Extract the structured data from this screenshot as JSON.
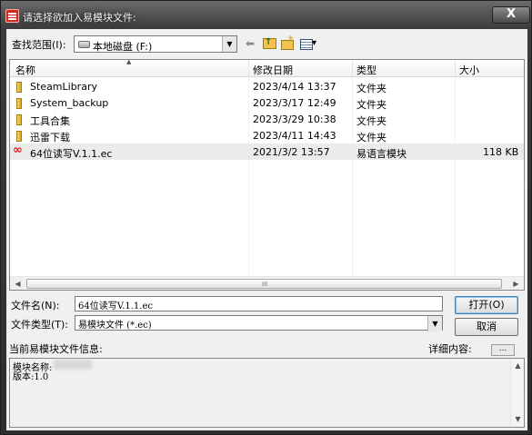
{
  "window": {
    "title": "请选择欲加入易模块文件:",
    "close_label": "X"
  },
  "lookin": {
    "label": "查找范围(I):",
    "value": "本地磁盘 (F:)"
  },
  "columns": {
    "name": "名称",
    "modified": "修改日期",
    "type": "类型",
    "size": "大小"
  },
  "files": [
    {
      "name": "SteamLibrary",
      "modified": "2023/4/14 13:37",
      "type": "文件夹",
      "size": "",
      "icon": "folder-icon"
    },
    {
      "name": "System_backup",
      "modified": "2023/3/17 12:49",
      "type": "文件夹",
      "size": "",
      "icon": "folder-icon"
    },
    {
      "name": "工具合集",
      "modified": "2023/3/29 10:38",
      "type": "文件夹",
      "size": "",
      "icon": "folder-icon"
    },
    {
      "name": "迅雷下载",
      "modified": "2023/4/11 14:43",
      "type": "文件夹",
      "size": "",
      "icon": "folder-icon"
    },
    {
      "name": "64位读写V.1.1.ec",
      "modified": "2021/3/2 13:57",
      "type": "易语言模块",
      "size": "118 KB",
      "icon": "ec-module-icon",
      "selected": true
    }
  ],
  "filename": {
    "label": "文件名(N):",
    "value": "64位读写V.1.1.ec"
  },
  "filetype": {
    "label": "文件类型(T):",
    "value": "易模块文件 (*.ec)"
  },
  "buttons": {
    "open": "打开(O)",
    "cancel": "取消"
  },
  "info": {
    "label": "当前易模块文件信息:",
    "detail_label": "详细内容:",
    "detail_button": "...",
    "module_name_label": "模块名称:",
    "version_line": "版本:1.0"
  },
  "scrollbar": {
    "grip": "III"
  }
}
